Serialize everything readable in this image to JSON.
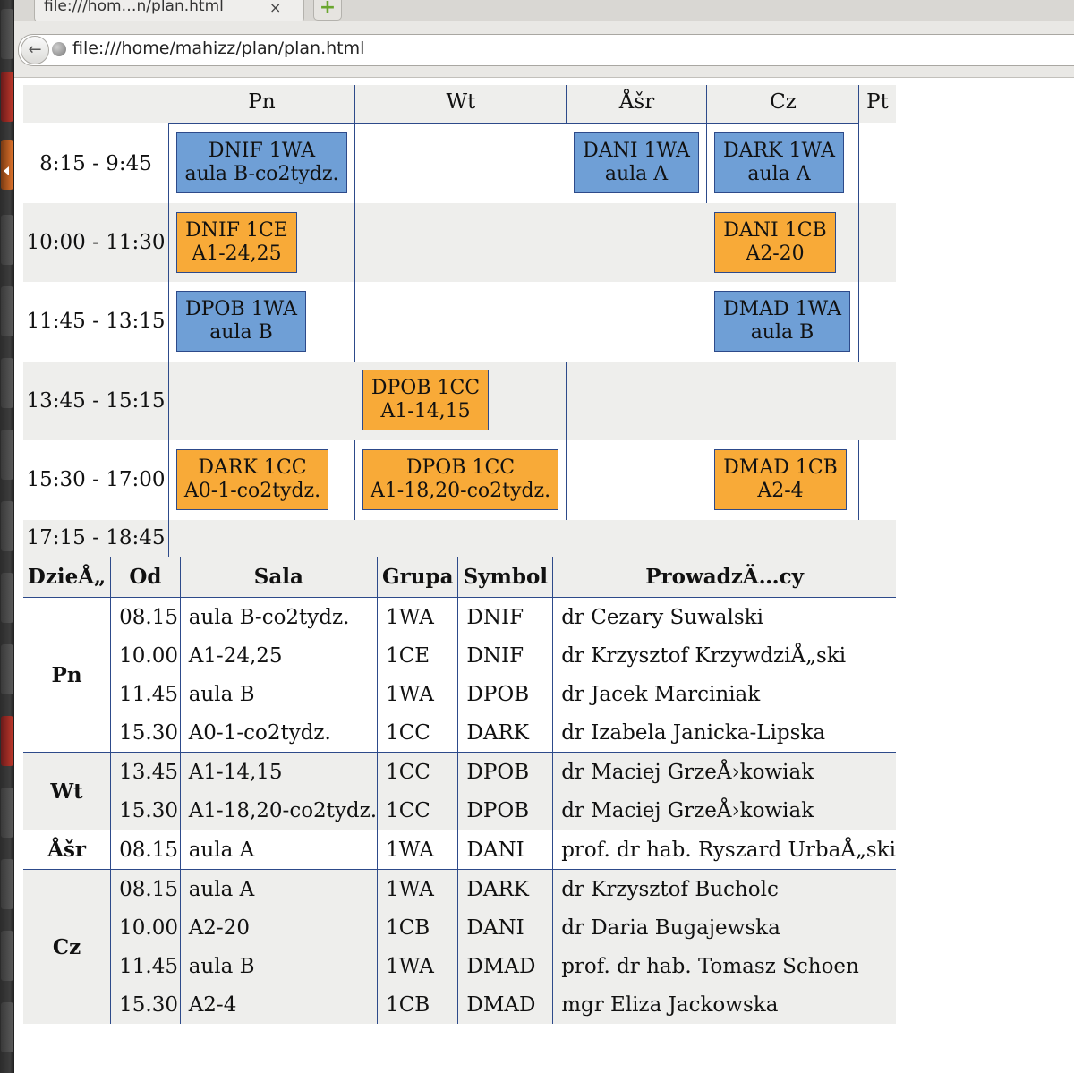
{
  "browser": {
    "tab_title": "file:///hom…n/plan.html",
    "tab_close": "×",
    "new_tab": "+",
    "back": "←",
    "url": "file:///home/mahizz/plan/plan.html"
  },
  "timetable": {
    "days": [
      "Pn",
      "Wt",
      "Åšr",
      "Cz",
      "Pt"
    ],
    "slots": [
      "8:15 - 9:45",
      "10:00 - 11:30",
      "11:45 - 13:15",
      "13:45 - 15:15",
      "15:30 - 17:00",
      "17:15 - 18:45"
    ],
    "classes": [
      {
        "line1": "DNIF 1WA",
        "line2": "aula B-co2tydz.",
        "color": "blue"
      },
      {
        "line1": "DANI 1WA",
        "line2": "aula A",
        "color": "blue"
      },
      {
        "line1": "DARK 1WA",
        "line2": "aula A",
        "color": "blue"
      },
      {
        "line1": "DNIF 1CE",
        "line2": "A1-24,25",
        "color": "orange"
      },
      {
        "line1": "DANI 1CB",
        "line2": "A2-20",
        "color": "orange"
      },
      {
        "line1": "DPOB 1WA",
        "line2": "aula B",
        "color": "blue"
      },
      {
        "line1": "DMAD 1WA",
        "line2": "aula B",
        "color": "blue"
      },
      {
        "line1": "DPOB 1CC",
        "line2": "A1-14,15",
        "color": "orange"
      },
      {
        "line1": "DARK 1CC",
        "line2": "A0-1-co2tydz.",
        "color": "orange"
      },
      {
        "line1": "DPOB 1CC",
        "line2": "A1-18,20-co2tydz.",
        "color": "orange"
      },
      {
        "line1": "DMAD 1CB",
        "line2": "A2-4",
        "color": "orange"
      }
    ],
    "colors": {
      "blue": "#6f9fd6",
      "orange": "#f8aa38",
      "line": "#2d4a8a",
      "band": "#eeeeec"
    }
  },
  "details": {
    "headers": [
      "DzieÅ„",
      "Od",
      "Sala",
      "Grupa",
      "Symbol",
      "ProwadzÄ…cy"
    ],
    "groups": [
      {
        "day": "Pn",
        "rows": [
          {
            "od": "08.15",
            "sala": "aula B-co2tydz.",
            "grupa": "1WA",
            "symbol": "DNIF",
            "prow": "dr Cezary Suwalski"
          },
          {
            "od": "10.00",
            "sala": "A1-24,25",
            "grupa": "1CE",
            "symbol": "DNIF",
            "prow": "dr Krzysztof KrzywdziÅ„ski"
          },
          {
            "od": "11.45",
            "sala": "aula B",
            "grupa": "1WA",
            "symbol": "DPOB",
            "prow": "dr Jacek Marciniak"
          },
          {
            "od": "15.30",
            "sala": "A0-1-co2tydz.",
            "grupa": "1CC",
            "symbol": "DARK",
            "prow": "dr Izabela Janicka-Lipska"
          }
        ]
      },
      {
        "day": "Wt",
        "rows": [
          {
            "od": "13.45",
            "sala": "A1-14,15",
            "grupa": "1CC",
            "symbol": "DPOB",
            "prow": "dr Maciej GrzeÅ›kowiak"
          },
          {
            "od": "15.30",
            "sala": "A1-18,20-co2tydz.",
            "grupa": "1CC",
            "symbol": "DPOB",
            "prow": "dr Maciej GrzeÅ›kowiak"
          }
        ]
      },
      {
        "day": "Åšr",
        "rows": [
          {
            "od": "08.15",
            "sala": "aula A",
            "grupa": "1WA",
            "symbol": "DANI",
            "prow": "prof. dr hab. Ryszard UrbaÅ„ski"
          }
        ]
      },
      {
        "day": "Cz",
        "rows": [
          {
            "od": "08.15",
            "sala": "aula A",
            "grupa": "1WA",
            "symbol": "DARK",
            "prow": "dr Krzysztof Bucholc"
          },
          {
            "od": "10.00",
            "sala": "A2-20",
            "grupa": "1CB",
            "symbol": "DANI",
            "prow": "dr Daria Bugajewska"
          },
          {
            "od": "11.45",
            "sala": "aula B",
            "grupa": "1WA",
            "symbol": "DMAD",
            "prow": "prof. dr hab. Tomasz Schoen"
          },
          {
            "od": "15.30",
            "sala": "A2-4",
            "grupa": "1CB",
            "symbol": "DMAD",
            "prow": "mgr Eliza Jackowska"
          }
        ]
      }
    ]
  }
}
